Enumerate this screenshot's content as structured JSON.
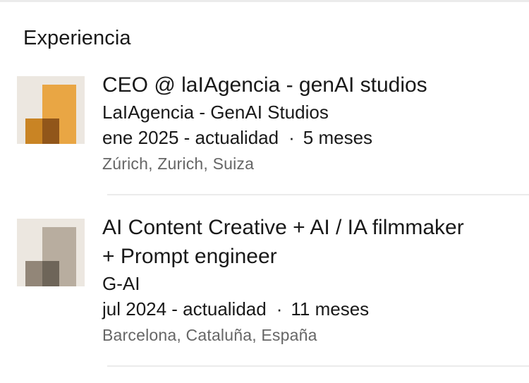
{
  "section": {
    "title": "Experiencia"
  },
  "experiences": [
    {
      "title": "CEO @ laIAgencia - genAI studios",
      "company": "LaIAgencia - GenAI Studios",
      "date_range": "ene 2025 - actualidad",
      "separator": "·",
      "duration": "5 meses",
      "location": "Zúrich, Zurich, Suiza",
      "logo_colors": {
        "background": "#ece7e0",
        "primary": "#e9a644",
        "secondary": "#c98424",
        "overlap": "#91561a"
      }
    },
    {
      "title_line1": "AI Content Creative + AI / IA filmmaker",
      "title_line2": "+ Prompt engineer",
      "company": "G-AI",
      "date_range": "jul 2024 - actualidad",
      "separator": "·",
      "duration": "11 meses",
      "location": "Barcelona, Cataluña, España",
      "logo_colors": {
        "background": "#ece7e0",
        "primary": "#b8ad9f",
        "secondary": "#928678",
        "overlap": "#6e6559"
      }
    }
  ]
}
